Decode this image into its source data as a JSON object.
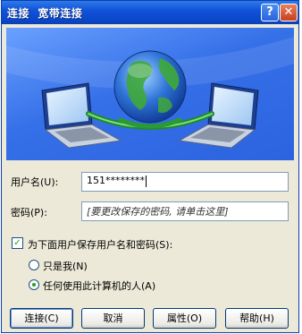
{
  "window": {
    "title": "连接  宽带连接",
    "help_icon": "?",
    "close_icon": "✕"
  },
  "colors": {
    "titlebar": "#0a47c9",
    "banner": "#3570e8",
    "check": "#21a121"
  },
  "form": {
    "username_label": "用户名(U):",
    "username_value": "151********",
    "password_label": "密码(P):",
    "password_value": "[要更改保存的密码, 请单击这里]",
    "save_checkbox_label": "为下面用户保存用户名和密码(S):",
    "save_checked": true,
    "radio_me_label": "只是我(N)",
    "radio_anyone_label": "任何使用此计算机的人(A)",
    "radio_selected": "anyone"
  },
  "buttons": {
    "connect": "连接(C)",
    "cancel": "取消",
    "properties": "属性(O)",
    "help": "帮助(H)"
  }
}
